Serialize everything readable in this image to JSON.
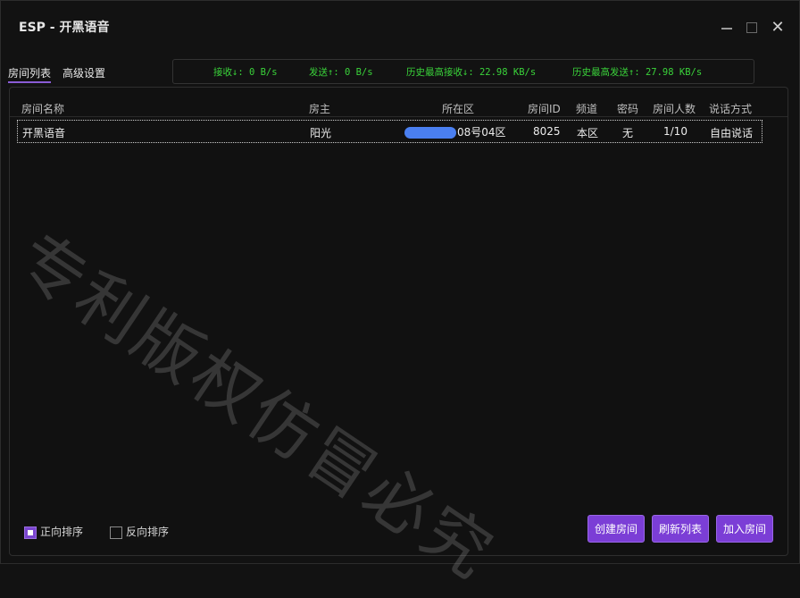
{
  "window": {
    "title": "ESP - 开黑语音"
  },
  "tabs": [
    {
      "label": "房间列表",
      "active": true
    },
    {
      "label": "高级设置",
      "active": false
    }
  ],
  "stats": {
    "recv": "接收↓: 0 B/s",
    "send": "发送↑: 0 B/s",
    "max_recv": "历史最高接收↓: 22.98 KB/s",
    "max_send": "历史最高发送↑: 27.98 KB/s"
  },
  "table": {
    "headers": [
      "房间名称",
      "房主",
      "所在区",
      "房间ID",
      "频道",
      "密码",
      "房间人数",
      "说话方式"
    ],
    "rows": [
      {
        "name": "开黑语音",
        "owner": "阳光",
        "zone": "08号04区",
        "id": "8025",
        "channel": "本区",
        "password": "无",
        "count": "1/10",
        "mode": "自由说话"
      }
    ]
  },
  "sort": {
    "asc_label": "正向排序",
    "asc_checked": true,
    "desc_label": "反向排序",
    "desc_checked": false
  },
  "buttons": {
    "create": "创建房间",
    "refresh": "刷新列表",
    "join": "加入房间"
  },
  "watermark": "专利版权仿冒必究",
  "colors": {
    "accent": "#7b3ed6",
    "stats_text": "#3ad33a",
    "redact": "#4a7ff0"
  }
}
